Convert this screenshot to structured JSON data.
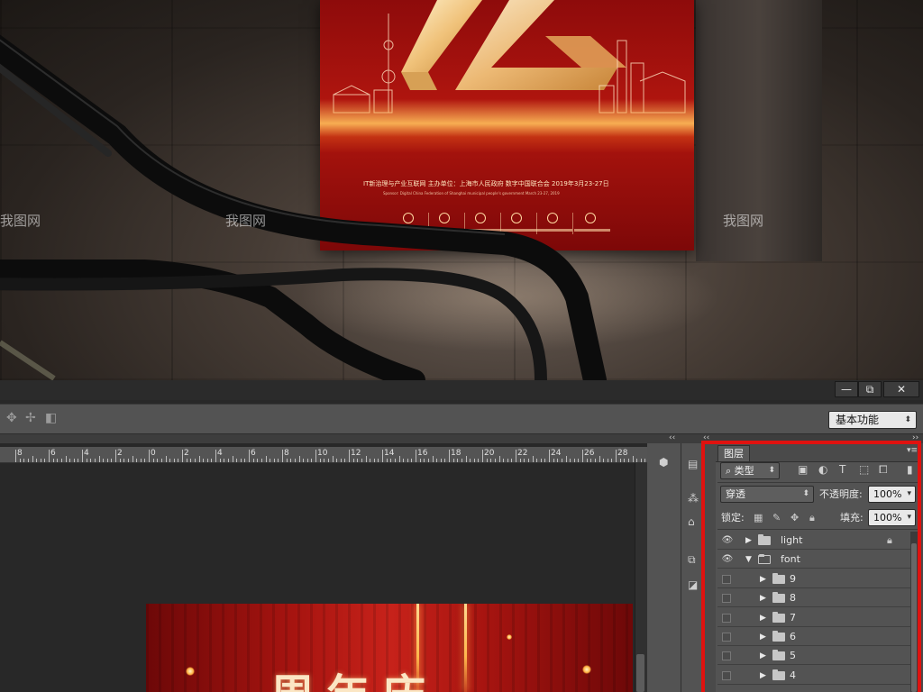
{
  "billboard": {
    "subtitle_line": "IT新治理与产业互联网    主办单位：上海市人民政府 数字中国联合会    2019年3月23-27日",
    "english_line": "Sponsor: Digital China Federation of Shanghai municipal people's government March 23-27, 2019"
  },
  "watermarks": [
    "我图网",
    "我图网",
    "我图网"
  ],
  "window": {
    "minimize": "—",
    "restore": "⧉",
    "close": "✕"
  },
  "options_bar": {
    "workspace_label": "基本功能"
  },
  "ruler": {
    "labels": [
      "8",
      "6",
      "4",
      "2",
      "0",
      "2",
      "4",
      "6",
      "8",
      "10",
      "12",
      "14",
      "16",
      "18",
      "20",
      "22",
      "24",
      "26",
      "28"
    ]
  },
  "document": {
    "title_visible": "周年庆"
  },
  "layers_panel": {
    "tab_label": "图层",
    "filter_label": "类型",
    "blend_mode": "穿透",
    "opacity_label": "不透明度:",
    "opacity_value": "100%",
    "lock_label": "锁定:",
    "fill_label": "填充:",
    "fill_value": "100%",
    "layers": [
      {
        "name": "light",
        "visible": true,
        "expanded": false,
        "locked": true,
        "indent": 0
      },
      {
        "name": "font",
        "visible": true,
        "expanded": true,
        "locked": false,
        "indent": 0
      },
      {
        "name": "9",
        "visible": false,
        "expanded": false,
        "locked": false,
        "indent": 1
      },
      {
        "name": "8",
        "visible": false,
        "expanded": false,
        "locked": false,
        "indent": 1
      },
      {
        "name": "7",
        "visible": false,
        "expanded": false,
        "locked": false,
        "indent": 1
      },
      {
        "name": "6",
        "visible": false,
        "expanded": false,
        "locked": false,
        "indent": 1
      },
      {
        "name": "5",
        "visible": false,
        "expanded": false,
        "locked": false,
        "indent": 1
      },
      {
        "name": "4",
        "visible": false,
        "expanded": false,
        "locked": false,
        "indent": 1
      }
    ]
  },
  "colors": {
    "highlight": "#e0120f",
    "panel_bg": "#535353",
    "poster_red": "#b3160f"
  }
}
